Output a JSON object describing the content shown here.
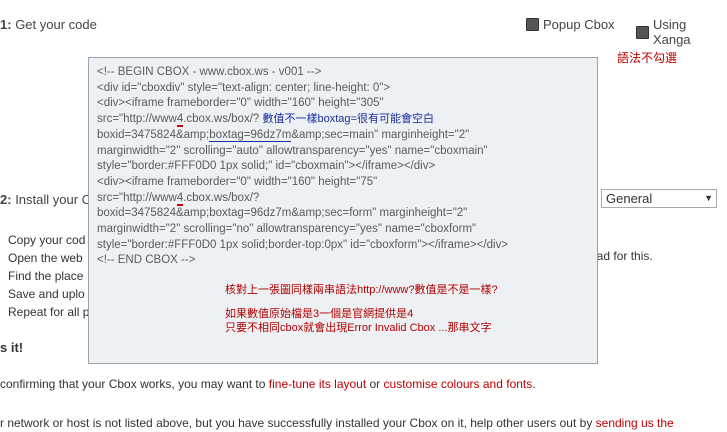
{
  "step1": {
    "num": "1:",
    "text": "Get your code"
  },
  "options": {
    "popup": "Popup Cbox",
    "xanga": "Using Xanga"
  },
  "annotation_right": "語法不勾選",
  "step2": {
    "num": "2:",
    "text": "Install your C"
  },
  "select": {
    "value": "General"
  },
  "side_text": "pad for this.",
  "list": [
    "Copy your cod",
    "Open the web",
    "Find the place",
    "Save and uplo",
    "Repeat for all p"
  ],
  "done_heading": "s it!",
  "para1": {
    "before": "confirming that your Cbox works, you may want to ",
    "link1": "fine-tune its layout",
    "mid": " or ",
    "link2": "customise colours and fonts",
    "after": "."
  },
  "para2": {
    "before": "r network or host is not listed above, but you have successfully installed your Cbox on it, help other users out by ",
    "link": "sending us the"
  },
  "code": {
    "l1": "<!-- BEGIN CBOX - www.cbox.ws - v001 -->",
    "l2": "<div id=\"cboxdiv\" style=\"text-align: center; line-height: 0\">",
    "l3": "<div><iframe frameborder=\"0\" width=\"160\" height=\"305\"",
    "l4a": "src=\"http://www",
    "l4b": "4",
    "l4c": ".cbox.ws/box/?",
    "l4note": "數值不一樣boxtag=很有可能會空白",
    "l5a": "boxid=3475824&amp;",
    "l5b": "boxtag=96dz7m",
    "l5c": "&amp;sec=main\" marginheight=\"2\"",
    "l6": "marginwidth=\"2\" scrolling=\"auto\" allowtransparency=\"yes\" name=\"cboxmain\"",
    "l7": "style=\"border:#FFF0D0 1px solid;\" id=\"cboxmain\"></iframe></div>",
    "l8": "<div><iframe frameborder=\"0\" width=\"160\" height=\"75\"",
    "l9a": "src=\"http://www",
    "l9b": "4",
    "l9c": ".cbox.ws/box/?",
    "l10": "boxid=3475824&amp;boxtag=96dz7m&amp;sec=form\" marginheight=\"2\"",
    "l11": "marginwidth=\"2\" scrolling=\"no\" allowtransparency=\"yes\" name=\"cboxform\"",
    "l12": "style=\"border:#FFF0D0 1px solid;border-top:0px\" id=\"cboxform\"></iframe></div>",
    "l13": "<!-- END CBOX -->"
  },
  "notes": {
    "n1": "核對上一張圖同樣兩串語法http://www?數值是不是一樣?",
    "n2": "如果數值原始檔是3一個是官網提供是4",
    "n3": "只要不相同cbox就會出現Error Invalid Cbox ...那串文字"
  },
  "colors": {
    "link": "#c00000",
    "annotation_blue": "#1a2fa0",
    "annotation_red": "#b00000",
    "codebox_bg": "#eef1f4"
  }
}
